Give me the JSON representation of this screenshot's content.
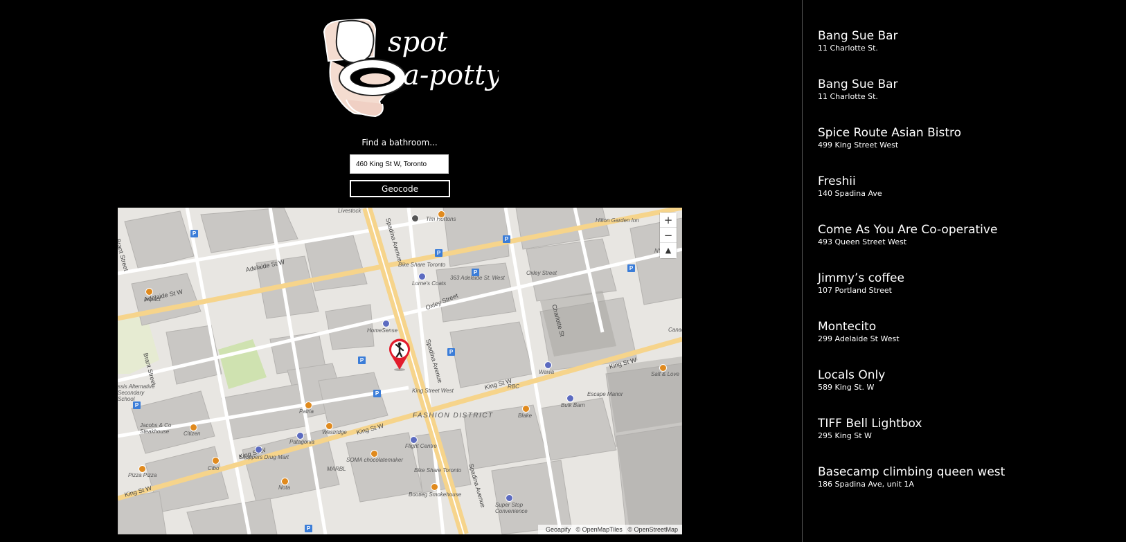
{
  "app": {
    "logo_text_line1": "spot",
    "logo_text_line2": "a-potty"
  },
  "search": {
    "label": "Find a bathroom...",
    "value": "460 King St W, Toronto",
    "button_label": "Geocode"
  },
  "map": {
    "zoom_in": "+",
    "zoom_out": "−",
    "reset_north": "▲",
    "attribution": [
      "Geoapify",
      "© OpenMapTiles",
      "© OpenStreetMap"
    ],
    "district": "FASHION DISTRICT",
    "streets": {
      "adelaide_1": "Adelaide St W",
      "adelaide_2": "Adelaide St W",
      "king_1": "King St W",
      "king_2": "King St W",
      "king_3": "King St W",
      "king_4": "King St W",
      "king_5": "King St W",
      "spadina_1": "Spadina Avenue",
      "spadina_2": "Spadina Avenue",
      "spadina_3": "Spadina Avenue",
      "oxley": "Oxley Street",
      "brant_1": "Brant Street",
      "brant_2": "Brant Street",
      "charlotte": "Charlotte St"
    },
    "pois": {
      "tim_hortons": "Tim Hortons",
      "hilton": "Hilton Garden Inn",
      "bike_share_1": "Bike Share Toronto",
      "adelaide_363": "363 Adelaide St. West",
      "oxley_street": "Oxley Street",
      "lornes": "Lorne's Coats",
      "homesense": "HomeSense",
      "impact": "Impact",
      "king_street_west": "King Street West",
      "rbc": "RBC",
      "wawa": "Wawa",
      "escape_manor": "Escape Manor",
      "bulk_barn": "Bulk Barn",
      "blake": "Blake",
      "patria": "Patria",
      "westridge": "Westridge",
      "patagonia": "Patagonia",
      "alternative_school": "ssis Alternative Secondary School",
      "jacobs": "Jacobs & Co Steakhouse",
      "citizen": "Citizen",
      "cibo": "Cibo",
      "shoppers": "Shoppers Drug Mart",
      "soma": "SOMA chocolatemaker",
      "flight_centre": "Flight Centre",
      "bike_share_2": "Bike Share Toronto",
      "marbl": "MARBL",
      "pizza_pizza": "Pizza Pizza",
      "nota": "Nota",
      "bootleg": "Bootleg Smokehouse",
      "super_stop": "Super Stop Convenience",
      "salt_love": "Salt & Love",
      "livestock": "Livestock",
      "canada": "Canad",
      "nyx": "NYX"
    }
  },
  "results": [
    {
      "name": "Bang Sue Bar",
      "address": "11 Charlotte St."
    },
    {
      "name": "Bang Sue Bar",
      "address": "11 Charlotte St."
    },
    {
      "name": "Spice Route Asian Bistro",
      "address": "499 King Street West"
    },
    {
      "name": "Freshii",
      "address": "140 Spadina Ave"
    },
    {
      "name": "Come As You Are Co-operative",
      "address": "493 Queen Street West"
    },
    {
      "name": "Jimmy’s coffee",
      "address": "107 Portland Street"
    },
    {
      "name": "Montecito",
      "address": "299 Adelaide St West"
    },
    {
      "name": "Locals Only",
      "address": "589 King St. W"
    },
    {
      "name": "TIFF Bell Lightbox",
      "address": "295 King St W"
    },
    {
      "name": "Basecamp climbing queen west",
      "address": "186 Spadina Ave, unit 1A"
    }
  ],
  "colors": {
    "background": "#000000",
    "major_road": "#f6d48b",
    "building": "#c8c6c3",
    "park": "#cfe2b0",
    "marker": "#e21c2c",
    "parking": "#3b7dd8"
  },
  "icons": {
    "marker": "person-pin-icon",
    "parking": "parking-icon",
    "logo": "toilet-logo-icon"
  }
}
